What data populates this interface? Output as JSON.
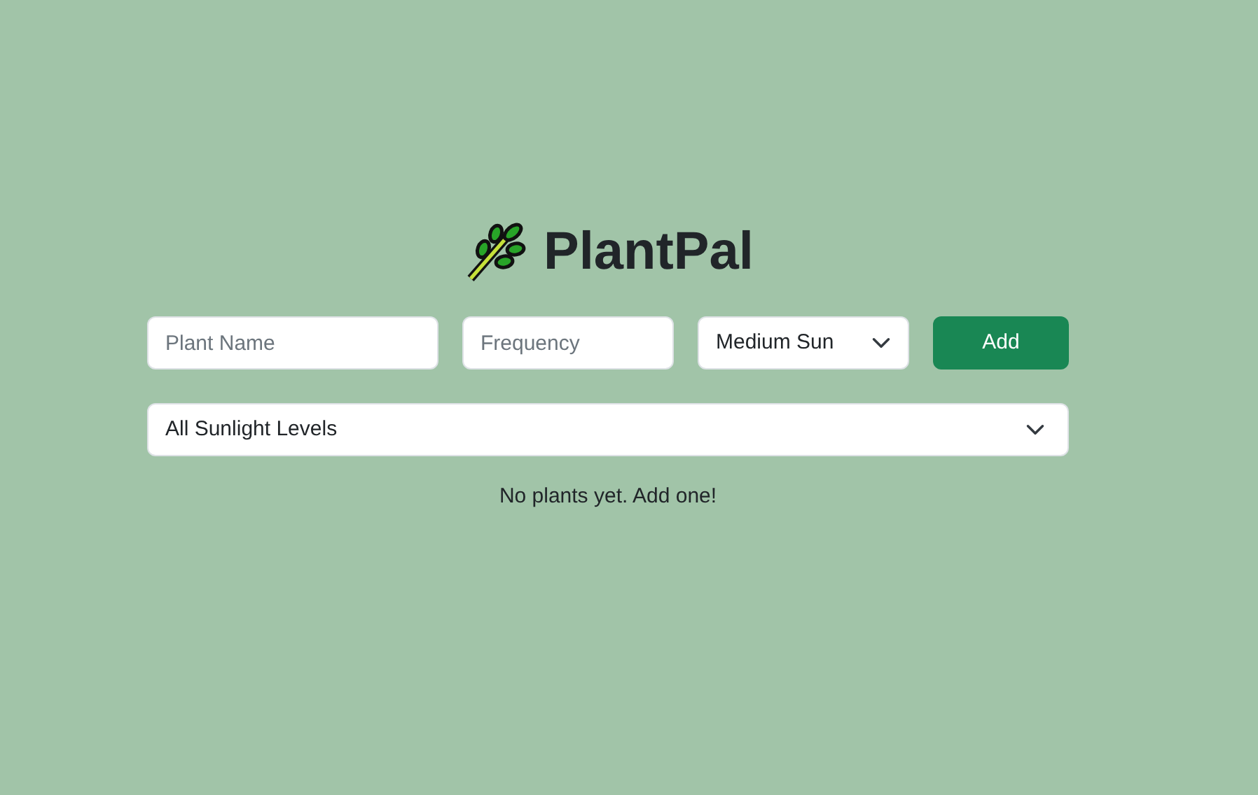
{
  "app": {
    "title": "PlantPal"
  },
  "form": {
    "name_field": {
      "placeholder": "Plant Name"
    },
    "frequency_field": {
      "placeholder": "Frequency"
    },
    "sunlight_select": {
      "value": "Medium Sun"
    },
    "add_button": {
      "label": "Add"
    }
  },
  "filter": {
    "value": "All Sunlight Levels"
  },
  "empty_message": "No plants yet. Add one!"
}
